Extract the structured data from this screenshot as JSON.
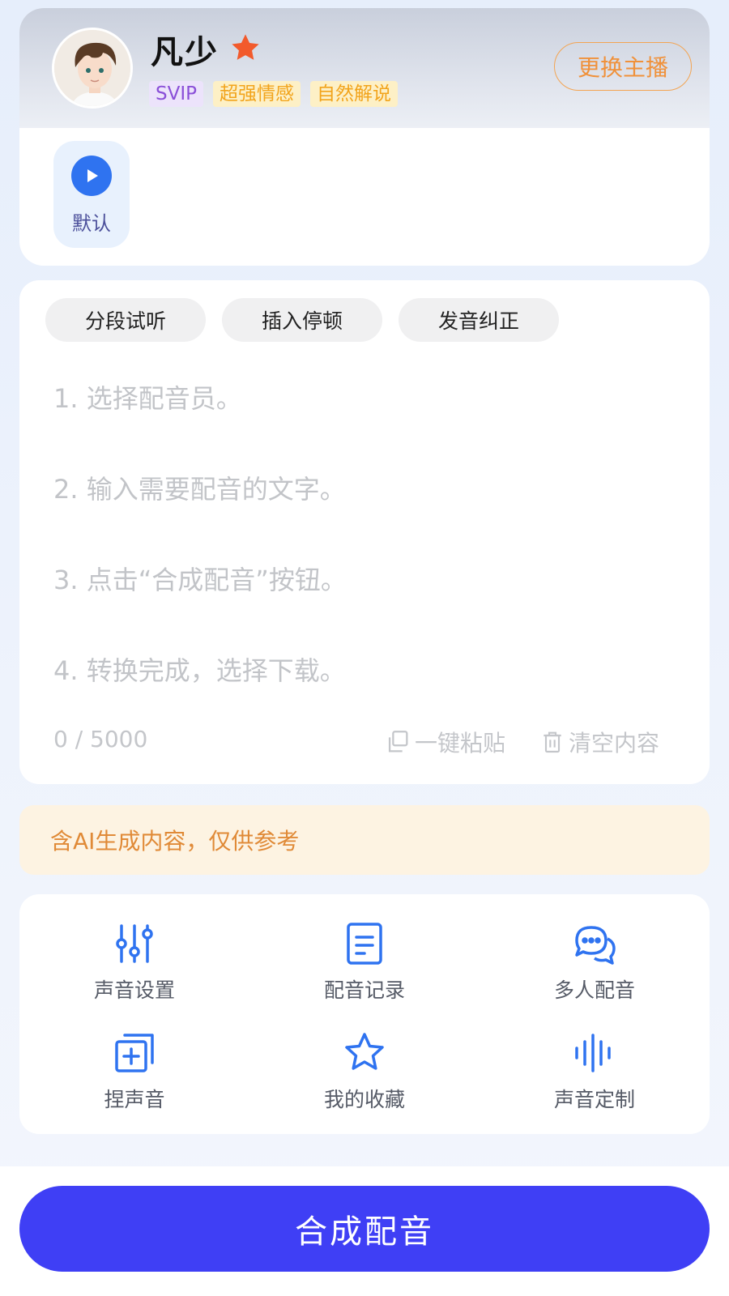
{
  "anchor": {
    "name": "凡少",
    "tags": [
      "SVIP",
      "超强情感",
      "自然解说"
    ],
    "change_label": "更换主播",
    "default_style_label": "默认"
  },
  "editor": {
    "tools": [
      "分段试听",
      "插入停顿",
      "发音纠正"
    ],
    "placeholder_lines": [
      "1. 选择配音员。",
      "2. 输入需要配音的文字。",
      "3. 点击“合成配音”按钮。",
      "4. 转换完成，选择下载。"
    ],
    "counter": "0 / 5000",
    "paste_label": "一键粘贴",
    "clear_label": "清空内容"
  },
  "notice": "含AI生成内容，仅供参考",
  "features": [
    {
      "label": "声音设置",
      "icon": "sliders-icon"
    },
    {
      "label": "配音记录",
      "icon": "document-icon"
    },
    {
      "label": "多人配音",
      "icon": "chat-bubbles-icon"
    },
    {
      "label": "捏声音",
      "icon": "add-layers-icon"
    },
    {
      "label": "我的收藏",
      "icon": "star-outline-icon"
    },
    {
      "label": "声音定制",
      "icon": "waveform-icon"
    }
  ],
  "synthesize_label": "合成配音",
  "colors": {
    "accent": "#3f3ff5",
    "icon_blue": "#2f73f0",
    "star_orange": "#f25a2c",
    "notice_text": "#e08a37"
  }
}
